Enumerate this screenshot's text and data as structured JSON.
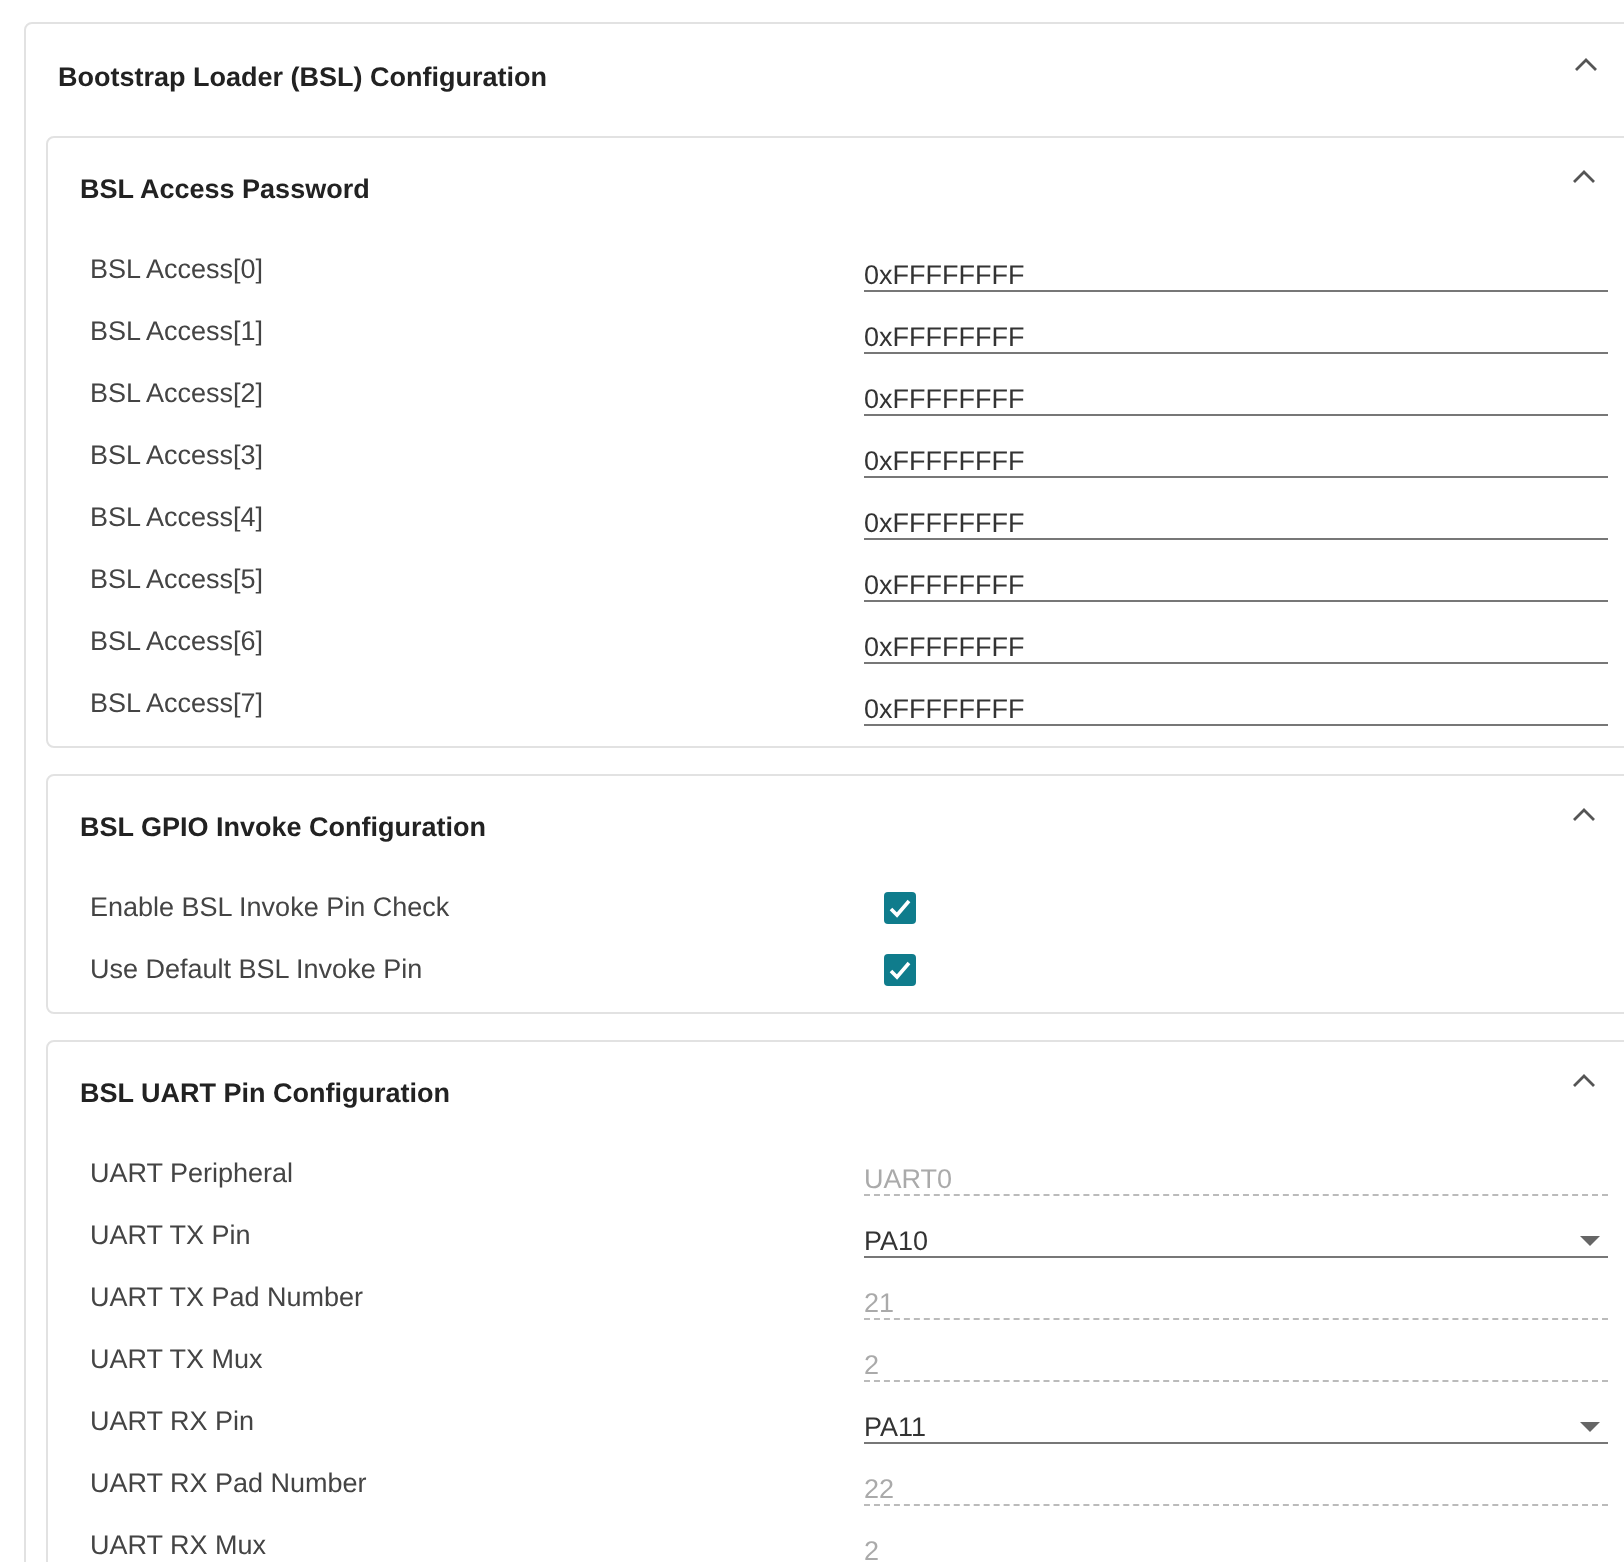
{
  "panel": {
    "title": "Bootstrap Loader (BSL) Configuration",
    "expanded": true,
    "sections": [
      {
        "title": "BSL Access Password",
        "expanded": true,
        "rows": [
          {
            "label": "BSL Access[0]",
            "kind": "text",
            "value": "0xFFFFFFFF"
          },
          {
            "label": "BSL Access[1]",
            "kind": "text",
            "value": "0xFFFFFFFF"
          },
          {
            "label": "BSL Access[2]",
            "kind": "text",
            "value": "0xFFFFFFFF"
          },
          {
            "label": "BSL Access[3]",
            "kind": "text",
            "value": "0xFFFFFFFF"
          },
          {
            "label": "BSL Access[4]",
            "kind": "text",
            "value": "0xFFFFFFFF"
          },
          {
            "label": "BSL Access[5]",
            "kind": "text",
            "value": "0xFFFFFFFF"
          },
          {
            "label": "BSL Access[6]",
            "kind": "text",
            "value": "0xFFFFFFFF"
          },
          {
            "label": "BSL Access[7]",
            "kind": "text",
            "value": "0xFFFFFFFF"
          }
        ]
      },
      {
        "title": "BSL GPIO Invoke Configuration",
        "expanded": true,
        "rows": [
          {
            "label": "Enable BSL Invoke Pin Check",
            "kind": "checkbox",
            "checked": true
          },
          {
            "label": "Use Default BSL Invoke Pin",
            "kind": "checkbox",
            "checked": true
          }
        ]
      },
      {
        "title": "BSL UART Pin Configuration",
        "expanded": true,
        "rows": [
          {
            "label": "UART Peripheral",
            "kind": "readonly",
            "value": "UART0"
          },
          {
            "label": "UART TX Pin",
            "kind": "select",
            "value": "PA10"
          },
          {
            "label": "UART TX Pad Number",
            "kind": "readonly",
            "value": "21"
          },
          {
            "label": "UART TX Mux",
            "kind": "readonly",
            "value": "2"
          },
          {
            "label": "UART RX Pin",
            "kind": "select",
            "value": "PA11"
          },
          {
            "label": "UART RX Pad Number",
            "kind": "readonly",
            "value": "22"
          },
          {
            "label": "UART RX Mux",
            "kind": "readonly",
            "value": "2"
          }
        ]
      }
    ]
  }
}
